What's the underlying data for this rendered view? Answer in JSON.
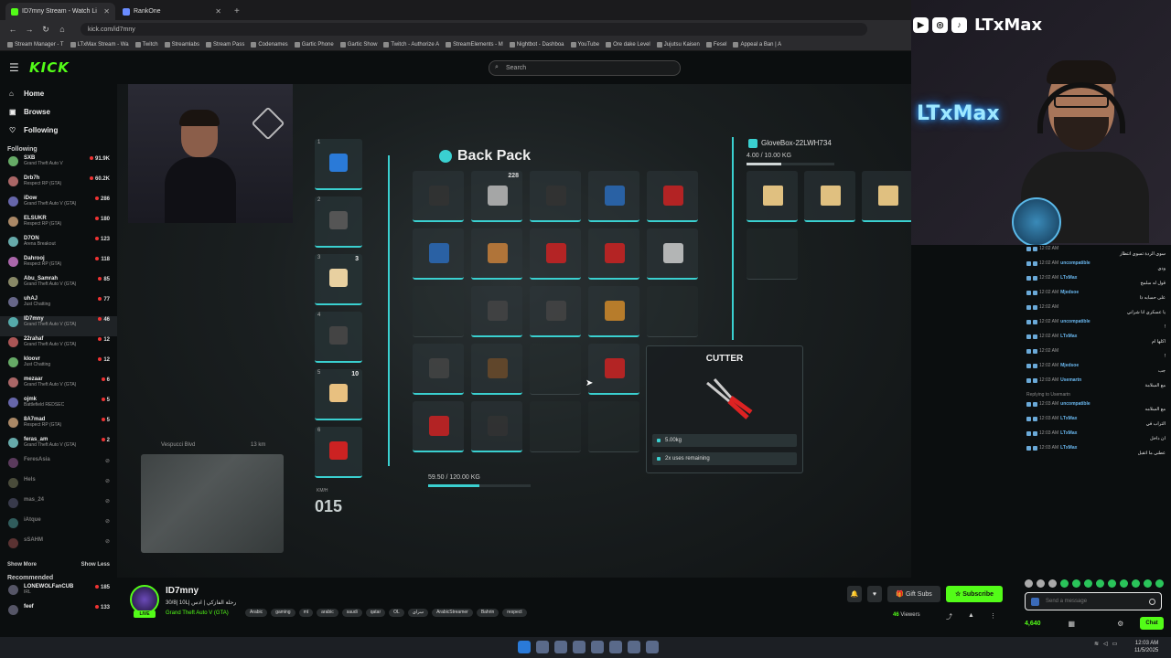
{
  "browser": {
    "tabs": [
      {
        "label": "ID7mny Stream - Watch Li",
        "active": true
      },
      {
        "label": "RankOne",
        "active": false
      }
    ],
    "url": "kick.com/id7mny",
    "bookmarks": [
      "Stream Manager - T",
      "LTxMax Stream - Wa",
      "Twitch",
      "Streamlabs",
      "Stream Pass",
      "Codenames",
      "Gartic Phone",
      "Gartic Show",
      "Twitch - Authorize A",
      "StreamElements - M",
      "Nightbot - Dashboa",
      "YouTube",
      "Ore dake Level",
      "Jujutsu Kaisen",
      "Fesel",
      "Appeal a Ban | A"
    ]
  },
  "kick": {
    "logo": "KICK",
    "search_placeholder": "Search",
    "nav": [
      {
        "label": "Home",
        "icon": "home-icon"
      },
      {
        "label": "Browse",
        "icon": "browse-icon"
      },
      {
        "label": "Following",
        "icon": "heart-icon"
      }
    ],
    "following_title": "Following",
    "following": [
      {
        "name": "SXB",
        "game": "Grand Theft Auto V",
        "viewers": "91.9K",
        "off": false
      },
      {
        "name": "Drb7h",
        "game": "Respect RP (GTA)",
        "viewers": "60.2K",
        "off": false
      },
      {
        "name": "iDow",
        "game": "Grand Theft Auto V (GTA)",
        "viewers": "286",
        "off": false
      },
      {
        "name": "ELSUKR",
        "game": "Respect RP (GTA)",
        "viewers": "180",
        "off": false
      },
      {
        "name": "D7ON",
        "game": "Arena Breakout",
        "viewers": "123",
        "off": false
      },
      {
        "name": "Dahrooj",
        "game": "Respect RP (GTA)",
        "viewers": "118",
        "off": false
      },
      {
        "name": "Abu_Samrah",
        "game": "Grand Theft Auto V (GTA)",
        "viewers": "85",
        "off": false
      },
      {
        "name": "uhAJ",
        "game": "Just Chatting",
        "viewers": "77",
        "off": false
      },
      {
        "name": "ID7mny",
        "game": "Grand Theft Auto V (GTA)",
        "viewers": "46",
        "off": false,
        "active": true
      },
      {
        "name": "22rahaf",
        "game": "Grand Theft Auto V (GTA)",
        "viewers": "12",
        "off": false
      },
      {
        "name": "kloovr",
        "game": "Just Chatting",
        "viewers": "12",
        "off": false
      },
      {
        "name": "mezaar",
        "game": "Grand Theft Auto V (GTA)",
        "viewers": "6",
        "off": false
      },
      {
        "name": "ojmk",
        "game": "Battlefield REDSEC",
        "viewers": "5",
        "off": false
      },
      {
        "name": "8A7mad",
        "game": "Respect RP (GTA)",
        "viewers": "5",
        "off": false
      },
      {
        "name": "feras_am",
        "game": "Grand Theft Auto V (GTA)",
        "viewers": "2",
        "off": false
      },
      {
        "name": "FeresAsia",
        "game": "",
        "viewers": "",
        "off": true
      },
      {
        "name": "Hels",
        "game": "",
        "viewers": "",
        "off": true
      },
      {
        "name": "mas_24",
        "game": "",
        "viewers": "",
        "off": true
      },
      {
        "name": "iAtque",
        "game": "",
        "viewers": "",
        "off": true
      },
      {
        "name": "sSAHM",
        "game": "",
        "viewers": "",
        "off": true
      }
    ],
    "show_more": "Show More",
    "show_less": "Show Less",
    "recommended_title": "Recommended",
    "recommended": [
      {
        "name": "LONEWOLFanCUB",
        "game": "IRL",
        "viewers": "185"
      },
      {
        "name": "feef",
        "game": "",
        "viewers": "133"
      }
    ]
  },
  "game": {
    "backpack_title": "Back Pack",
    "backpack_weight": "59.50 / 120.00 KG",
    "backpack_fill": 0.496,
    "hotbar_counts": [
      "",
      "",
      "3",
      "",
      "10",
      ""
    ],
    "hotbar_nums": [
      "1",
      "2",
      "3",
      "4",
      "5",
      "6"
    ],
    "grid_counts": [
      "",
      "228",
      "",
      "",
      "",
      "",
      "",
      "",
      "",
      "",
      "",
      "",
      "",
      "",
      "",
      "",
      "",
      "",
      "",
      "",
      "",
      "",
      "",
      ""
    ],
    "glovebox_title": "GloveBox-22LWH734",
    "glovebox_weight": "4.00 / 10.00 KG",
    "glovebox_fill": 0.4,
    "tooltip_title": "CUTTER",
    "tooltip_weight": "5.00kg",
    "tooltip_uses": "2x uses remaining",
    "location": "Vespucci Blvd",
    "distance": "13 km",
    "speed_unit": "KM/H",
    "speed": "015"
  },
  "overlay": {
    "brand_name": "LTxMax",
    "neon_sign": "LTxMax"
  },
  "chat": {
    "messages": [
      {
        "time": "12:02 AM",
        "user": "",
        "text": "سوي الردة تسوي انتظار"
      },
      {
        "time": "12:02 AM",
        "user": "uncompatible",
        "text": "ودي"
      },
      {
        "time": "12:02 AM",
        "user": "LTxMax",
        "text": "قول له سلمح"
      },
      {
        "time": "12:02 AM",
        "user": "Mjedsoe",
        "text": "على حسابه ذا"
      },
      {
        "time": "12:02 AM",
        "user": "",
        "text": "يا عسكري انا شراني"
      },
      {
        "time": "12:02 AM",
        "user": "uncompatible",
        "text": "!"
      },
      {
        "time": "12:02 AM",
        "user": "LTxMax",
        "text": "اكلها ام"
      },
      {
        "time": "12:02 AM",
        "user": "",
        "text": "!"
      },
      {
        "time": "12:02 AM",
        "user": "Mjedsoe",
        "text": "جب"
      },
      {
        "time": "12:03 AM",
        "user": "Usemartn",
        "text": "مع السلامة"
      },
      {
        "time": "12:03 AM",
        "user": "uncompatible",
        "text": "مع السلامه"
      },
      {
        "time": "12:03 AM",
        "user": "LTxMax",
        "text": "التراب في"
      },
      {
        "time": "12:03 AM",
        "user": "LTxMax",
        "text": "ان داخل"
      },
      {
        "time": "12:03 AM",
        "user": "LTxMax",
        "text": "عطني ما اتقبل"
      }
    ],
    "replying_to": "Replying to Usemartn",
    "input_placeholder": "Send a message",
    "points": "4,640",
    "chat_button": "Chat"
  },
  "channel": {
    "name": "ID7mny",
    "title": "30/8| 10L| رحلة الفازكي | ادس",
    "category": "Grand Theft Auto V (GTA)",
    "live": "LIVE",
    "tags": [
      "Arabic",
      "gaming",
      "mt",
      "arabic",
      "saudi",
      "qatar",
      "OL",
      "سراي",
      "ArabicStreamer",
      "Bahrin",
      "respect"
    ],
    "gift_subs": "Gift Subs",
    "subscribe": "Subscribe",
    "viewers_count": "46",
    "viewers_label": "Viewers"
  },
  "taskbar": {
    "time": "12:03 AM",
    "date": "11/5/2025"
  }
}
